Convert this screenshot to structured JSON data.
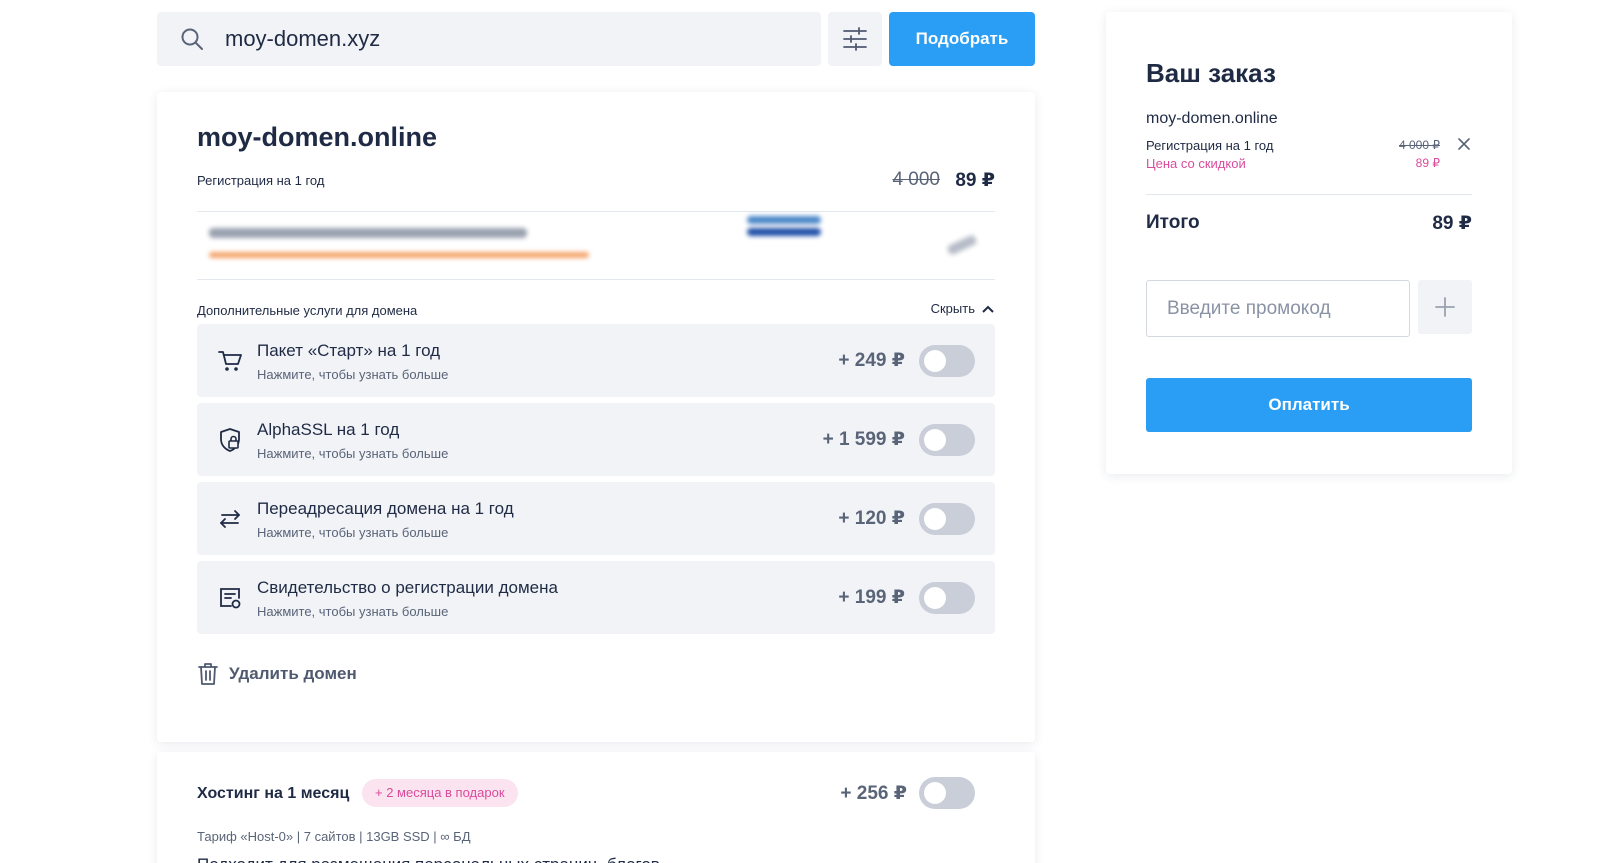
{
  "search": {
    "value": "moy-domen.xyz",
    "button_label": "Подобрать"
  },
  "domain": {
    "name": "moy-domen.online",
    "registration_label": "Регистрация на 1 год",
    "price_old": "4 000",
    "price_new": "89 ₽",
    "extras_label": "Дополнительные услуги для домена",
    "hide_label": "Скрыть",
    "services": [
      {
        "icon": "cart-icon",
        "title": "Пакет «Старт» на 1 год",
        "subtitle": "Нажмите, чтобы узнать больше",
        "price": "+ 249 ₽",
        "enabled": false
      },
      {
        "icon": "shield-lock-icon",
        "title": "AlphaSSL на 1 год",
        "subtitle": "Нажмите, чтобы узнать больше",
        "price": "+ 1 599 ₽",
        "enabled": false
      },
      {
        "icon": "redirect-arrows-icon",
        "title": "Переадресация домена на 1 год",
        "subtitle": "Нажмите, чтобы узнать больше",
        "price": "+ 120 ₽",
        "enabled": false
      },
      {
        "icon": "certificate-icon",
        "title": "Свидетельство о регистрации домена",
        "subtitle": "Нажмите, чтобы узнать больше",
        "price": "+ 199 ₽",
        "enabled": false
      }
    ],
    "delete_label": "Удалить домен"
  },
  "hosting": {
    "title": "Хостинг на 1 месяц",
    "badge": "+ 2 месяца в подарок",
    "price": "+ 256 ₽",
    "enabled": false,
    "specs": "Тариф «Host-0» | 7 сайтов | 13GB SSD | ∞ БД",
    "description": "Подходит для размещения персональных страниц, блогов"
  },
  "order": {
    "title": "Ваш заказ",
    "domain": "moy-domen.online",
    "registration_label": "Регистрация на 1 год",
    "price_old": "4 000 ₽",
    "discount_label": "Цена со скидкой",
    "discount_price": "89 ₽",
    "total_label": "Итого",
    "total_value": "89 ₽",
    "promo_placeholder": "Введите промокод",
    "pay_label": "Оплатить"
  },
  "colors": {
    "accent": "#2a9df4",
    "discount": "#d94c9c",
    "surface": "#f1f3f7",
    "toggle_off": "#c9ced8"
  }
}
